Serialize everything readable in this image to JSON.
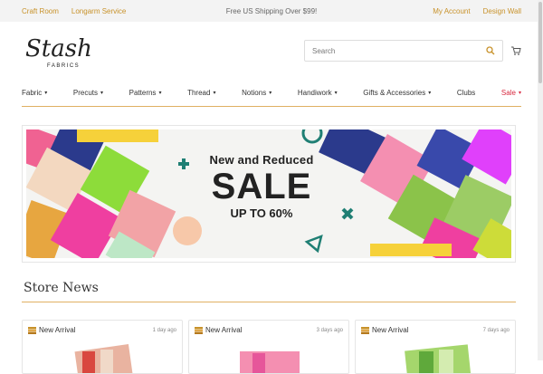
{
  "topbar": {
    "links_left": [
      "Craft Room",
      "Longarm Service"
    ],
    "shipping": "Free US Shipping Over $99!",
    "links_right": [
      "My Account",
      "Design Wall"
    ]
  },
  "header": {
    "logo_text": "Stash",
    "logo_sub": "FABRICS",
    "search_placeholder": "Search"
  },
  "nav": {
    "items": [
      {
        "label": "Fabric"
      },
      {
        "label": "Precuts"
      },
      {
        "label": "Patterns"
      },
      {
        "label": "Thread"
      },
      {
        "label": "Notions"
      },
      {
        "label": "Handiwork"
      },
      {
        "label": "Gifts & Accessories"
      },
      {
        "label": "Clubs"
      },
      {
        "label": "Sale"
      }
    ]
  },
  "banner": {
    "subtitle": "New and Reduced",
    "headline": "SALE",
    "discount": "UP TO 60%"
  },
  "news": {
    "title": "Store News",
    "cards": [
      {
        "tag": "New Arrival",
        "ago": "1 day ago"
      },
      {
        "tag": "New Arrival",
        "ago": "3 days ago"
      },
      {
        "tag": "New Arrival",
        "ago": "7 days ago"
      }
    ]
  },
  "colors": {
    "accent": "#c8922a",
    "sale": "#d8283f",
    "teal": "#1f7f74"
  }
}
